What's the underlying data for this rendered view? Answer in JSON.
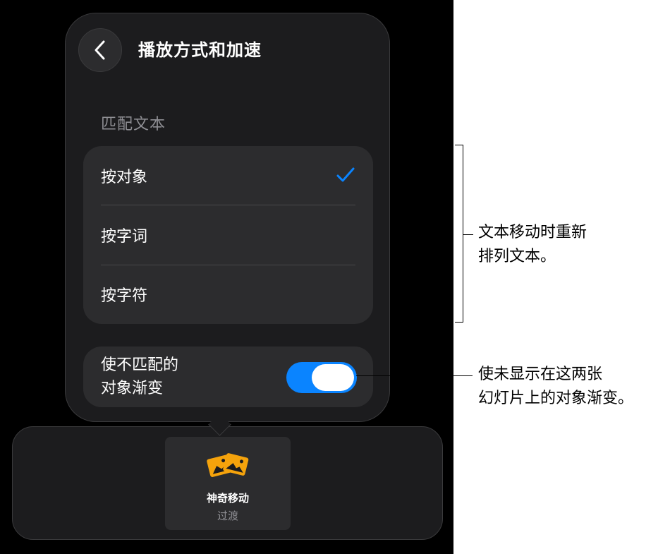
{
  "popover": {
    "title": "播放方式和加速",
    "section_header": "匹配文本",
    "options": [
      {
        "label": "按对象",
        "selected": true
      },
      {
        "label": "按字词",
        "selected": false
      },
      {
        "label": "按字符",
        "selected": false
      }
    ],
    "toggle": {
      "label_line1": "使不匹配的",
      "label_line2": "对象渐变",
      "on": true
    }
  },
  "bottom_panel": {
    "card_title": "神奇移动",
    "card_subtitle": "过渡"
  },
  "callouts": {
    "top_line1": "文本移动时重新",
    "top_line2": "排列文本。",
    "bottom_line1": "使未显示在这两张",
    "bottom_line2": "幻灯片上的对象渐变。"
  },
  "colors": {
    "accent": "#0a84ff",
    "icon_yellow": "#f5a30c",
    "panel": "#1c1c1e",
    "group": "#2c2c2e"
  },
  "icons": {
    "back": "chevron-left-icon",
    "check": "checkmark-icon",
    "transition": "magic-move-icon"
  }
}
